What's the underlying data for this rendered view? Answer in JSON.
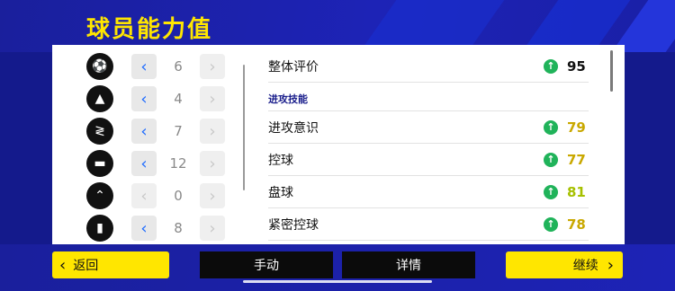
{
  "title": "球员能力值",
  "left_rows": [
    {
      "icon": "soccer-ball-icon",
      "glyph": "⚽",
      "value": "6",
      "left_active": true
    },
    {
      "icon": "cone-icon",
      "glyph": "▲",
      "value": "4",
      "left_active": true
    },
    {
      "icon": "zigzag-icon",
      "glyph": "⟲",
      "value": "7",
      "left_active": true
    },
    {
      "icon": "boot-icon",
      "glyph": "👟",
      "value": "12",
      "left_active": true
    },
    {
      "icon": "chevrons-up-icon",
      "glyph": "⌃",
      "value": "0",
      "left_active": false
    },
    {
      "icon": "shield-icon",
      "glyph": "⛨",
      "value": "8",
      "left_active": true
    }
  ],
  "overall": {
    "label": "整体评价",
    "value": "95",
    "color": "#111111"
  },
  "section_label": "进攻技能",
  "stats": [
    {
      "label": "进攻意识",
      "value": "79",
      "color": "#c9a800"
    },
    {
      "label": "控球",
      "value": "77",
      "color": "#c9a800"
    },
    {
      "label": "盘球",
      "value": "81",
      "color": "#a6c000"
    },
    {
      "label": "紧密控球",
      "value": "78",
      "color": "#c9a800"
    }
  ],
  "buttons": {
    "back_label": "返回",
    "manual_label": "手动",
    "details_label": "详情",
    "continue_label": "继续"
  }
}
